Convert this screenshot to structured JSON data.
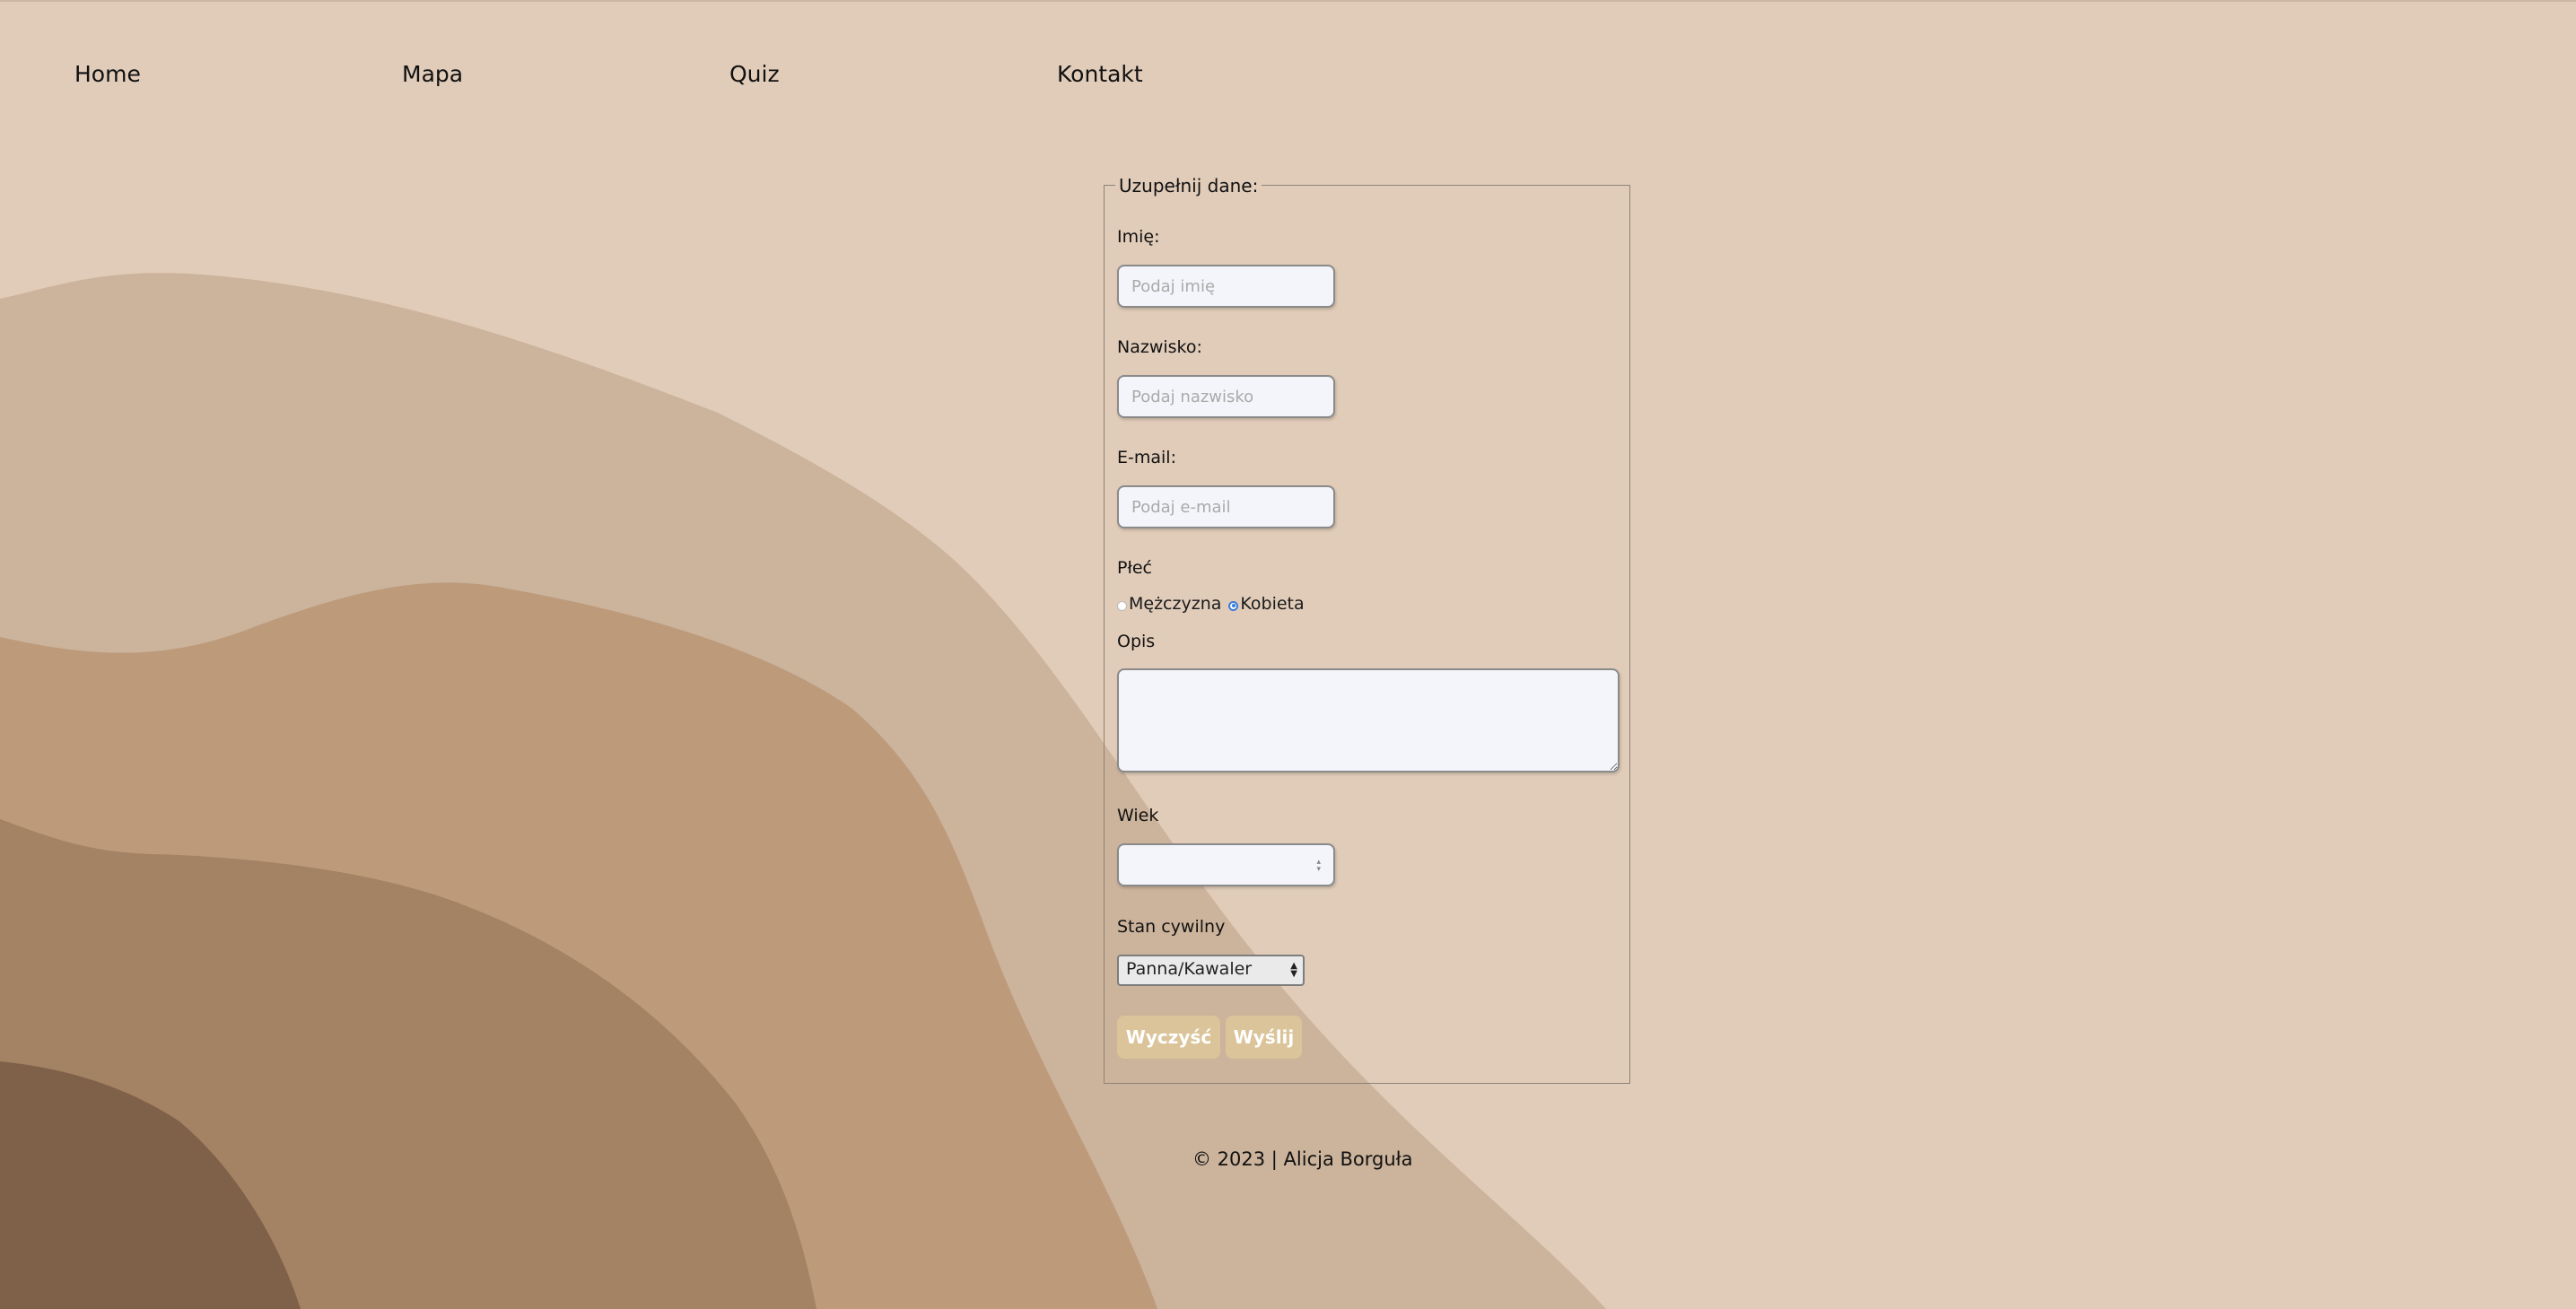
{
  "colors": {
    "background": "#e1ccb9",
    "wave_1": "#ccb39c",
    "wave_2": "#bc9a7a",
    "wave_3": "#a48264",
    "wave_4": "#7f6049",
    "button": "#dbc49a",
    "radio_checked": "#3b7bd9"
  },
  "nav": {
    "home": "Home",
    "mapa": "Mapa",
    "quiz": "Quiz",
    "kontakt": "Kontakt"
  },
  "form": {
    "legend": "Uzupełnij dane:",
    "first_name": {
      "label": "Imię:",
      "placeholder": "Podaj imię",
      "value": ""
    },
    "last_name": {
      "label": "Nazwisko:",
      "placeholder": "Podaj nazwisko",
      "value": ""
    },
    "email": {
      "label": "E-mail:",
      "placeholder": "Podaj e-mail",
      "value": ""
    },
    "gender": {
      "label": "Płeć",
      "options": [
        "Mężczyzna",
        "Kobieta"
      ],
      "selected": "Kobieta"
    },
    "description": {
      "label": "Opis",
      "value": ""
    },
    "age": {
      "label": "Wiek",
      "value": ""
    },
    "marital_status": {
      "label": "Stan cywilny",
      "selected": "Panna/Kawaler"
    },
    "clear_button": "Wyczyść",
    "submit_button": "Wyślij"
  },
  "footer": "© 2023 | Alicja Borguła"
}
